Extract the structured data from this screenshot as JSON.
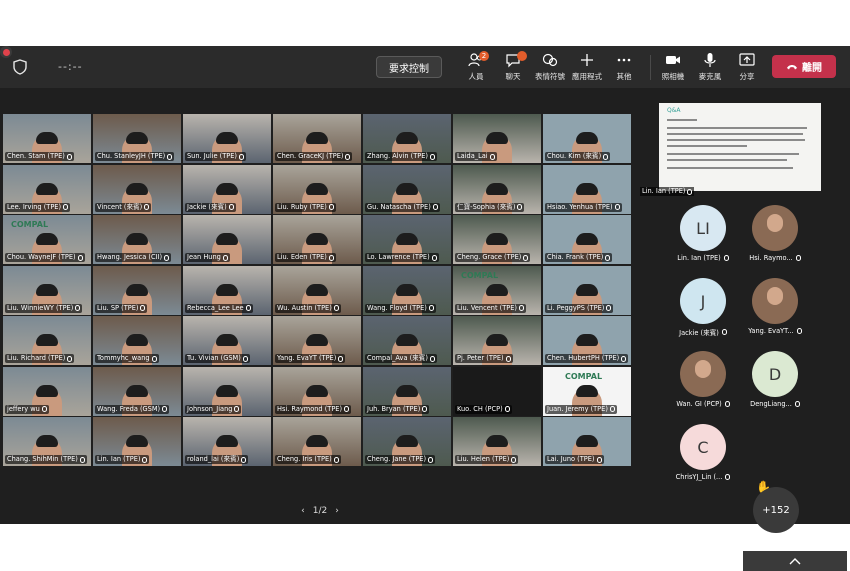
{
  "toolbar": {
    "timer": "--:--",
    "request_control": "要求控制",
    "people_badge": "2",
    "tools": [
      {
        "label": "人員",
        "icon": "people-icon"
      },
      {
        "label": "聊天",
        "icon": "chat-icon"
      },
      {
        "label": "表情符號",
        "icon": "emoji-icon"
      },
      {
        "label": "應用程式",
        "icon": "apps-icon"
      },
      {
        "label": "其他",
        "icon": "more-icon"
      },
      {
        "label": "照相機",
        "icon": "camera-icon"
      },
      {
        "label": "麥克風",
        "icon": "mic-icon"
      },
      {
        "label": "分享",
        "icon": "share-icon"
      }
    ],
    "leave": "離開",
    "leave_color": "#c4314b"
  },
  "grid": {
    "tiles": [
      "Chen. Stam (TPE)",
      "Chu. StanleyJH (TPE)",
      "Sun. Julie (TPE)",
      "Chen. GraceKJ (TPE)",
      "Zhang. Alvin (TPE)",
      "Laida_Lai",
      "Chou. Kim (來賓)",
      "Lee. Irving (TPE)",
      "Vincent (來賓)",
      "Jackie (來賓)",
      "Liu. Ruby (TPE)",
      "Gu. Natascha (TPE)",
      "仁寶-Sophia (來賓)",
      "Hsiao. Yenhua (TPE)",
      "Chou. WayneJF (TPE)",
      "Hwang. Jessica (CII)",
      "Jean Hung",
      "Liu. Eden (TPE)",
      "Lo. Lawrence (TPE)",
      "Cheng. Grace (TPE)",
      "Chia. Frank (TPE)",
      "Liu. WinnieWY (TPE)",
      "Liu. SP (TPE)",
      "Rebecca_Lee Lee",
      "Wu. Austin (TPE)",
      "Wang. Floyd (TPE)",
      "Liu. Vencent (TPE)",
      "Li. PeggyPS (TPE)",
      "Liu. Richard (TPE)",
      "Tommyhc_wang",
      "Tu. Vivian (GSM)",
      "Yang. EvaYT (TPE)",
      "Compal_Ava (來賓)",
      "Pj. Peter (TPE)",
      "Chen. HubertPH (TPE)",
      "jeffery wu",
      "Wang. Freda (GSM)",
      "Johnson_Jiang",
      "Hsi. Raymond (TPE)",
      "Juh. Bryan (TPE)",
      "Kuo. CH (PCP)",
      "Juan. Jeremy (TPE)",
      "Chang. ShihMin (TPE)",
      "Lin. Ian (TPE)",
      "roland_lai (來賓)",
      "Cheng. Iris (TPE)",
      "Cheng. Jane (TPE)",
      "Liu. Helen (TPE)",
      "Lai. Juno (TPE)"
    ],
    "logo_text": "COMPAL"
  },
  "pager": {
    "label": "1/2"
  },
  "share": {
    "presenter": "Lin. Ian (TPE)",
    "header": "Q&A"
  },
  "people": [
    {
      "initials": "LI",
      "name": "Lin. Ian (TPE)",
      "color": "#d8e8f2"
    },
    {
      "initials": "",
      "name": "Hsi. Raymo...",
      "color": "#8a6a54"
    },
    {
      "initials": "J",
      "name": "Jackie (來賓)",
      "color": "#cfe6f0"
    },
    {
      "initials": "",
      "name": "Yang. EvaYT...",
      "color": "#8a6a54"
    },
    {
      "initials": "",
      "name": "Wan. GI (PCP)",
      "color": "#8a6a54"
    },
    {
      "initials": "D",
      "name": "DengLiang...",
      "color": "#dbe9d2"
    },
    {
      "initials": "C",
      "name": "ChrisYJ_Lin (...",
      "color": "#f6dada"
    }
  ],
  "overflow": {
    "count": "+152"
  }
}
